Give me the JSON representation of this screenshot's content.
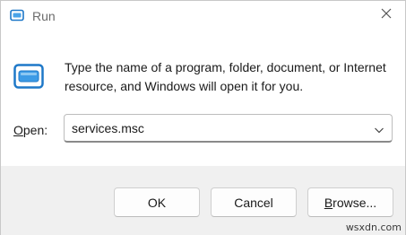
{
  "window": {
    "title": "Run",
    "title_icon": "run-icon",
    "close_icon": "close-icon"
  },
  "content": {
    "icon": "run-app-icon",
    "description": "Type the name of a program, folder, document, or Internet resource, and Windows will open it for you.",
    "open_label_mnemonic": "O",
    "open_label_rest": "pen:",
    "open_value": "services.msc",
    "dropdown_icon": "chevron-down-icon"
  },
  "buttons": {
    "ok": "OK",
    "cancel": "Cancel",
    "browse_mnemonic": "B",
    "browse_rest": "rowse..."
  },
  "watermark": "wsxdn.com",
  "colors": {
    "accent": "#1e78c8",
    "footer_bg": "#f0f0f0"
  }
}
